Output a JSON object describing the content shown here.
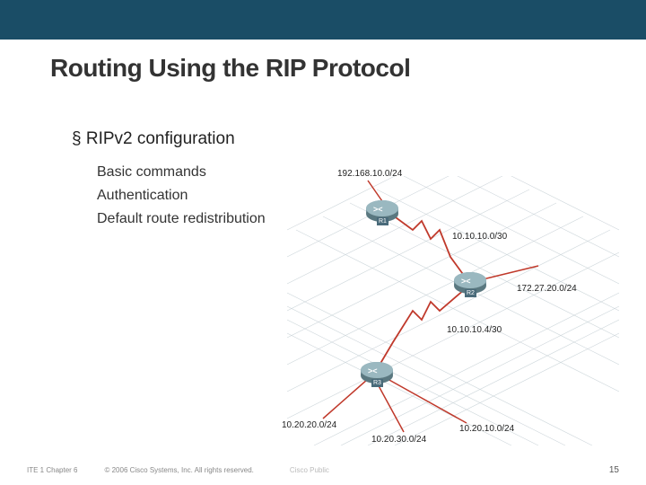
{
  "header": {
    "title": "Routing Using the RIP Protocol"
  },
  "body": {
    "subtitle": "§ RIPv2 configuration",
    "items": [
      "Basic commands",
      "Authentication",
      "Default route redistribution"
    ]
  },
  "diagram": {
    "routers": {
      "r1": "R1",
      "r2": "R2",
      "r3": "R3"
    },
    "labels": {
      "top": "192.168.10.0/24",
      "r1_r2": "10.10.10.0/30",
      "r2_right": "172.27.20.0/24",
      "r2_r3": "10.10.10.4/30",
      "r3_left": "10.20.20.0/24",
      "r3_mid": "10.20.30.0/24",
      "r3_right": "10.20.10.0/24"
    }
  },
  "footer": {
    "chapter": "ITE 1 Chapter 6",
    "copyright": "© 2006 Cisco Systems, Inc. All rights reserved.",
    "public": "Cisco Public",
    "page": "15"
  }
}
